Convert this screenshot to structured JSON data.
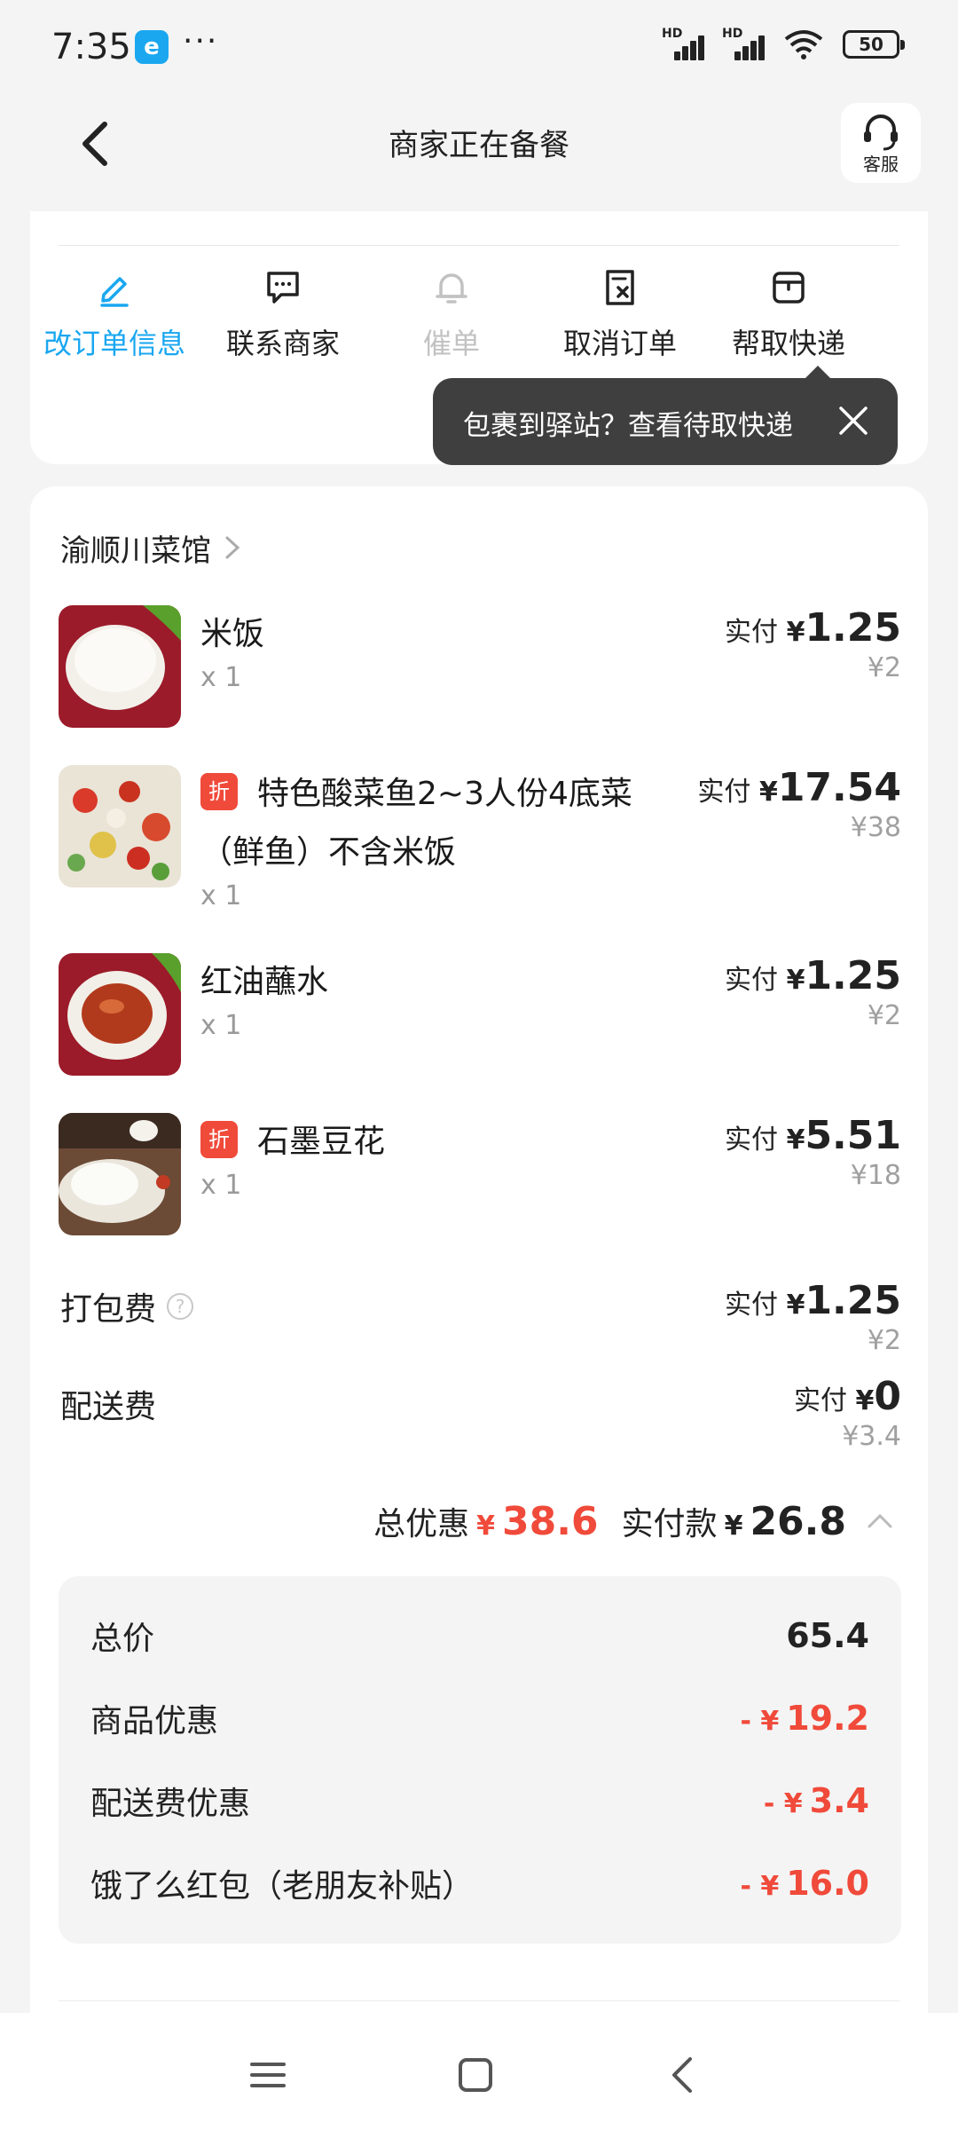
{
  "status_bar": {
    "time": "7:35",
    "app_icon_name": "eleme-app-icon",
    "more": "···",
    "battery": "50"
  },
  "header": {
    "title": "商家正在备餐",
    "service_label": "客服"
  },
  "actions": [
    {
      "label": "改订单信息",
      "icon": "edit-icon",
      "state": "active"
    },
    {
      "label": "联系商家",
      "icon": "chat-icon",
      "state": "normal"
    },
    {
      "label": "催单",
      "icon": "bell-icon",
      "state": "disabled"
    },
    {
      "label": "取消订单",
      "icon": "cancel-doc-icon",
      "state": "normal"
    },
    {
      "label": "帮取快递",
      "icon": "parcel-icon",
      "state": "normal"
    }
  ],
  "tooltip": {
    "text": "包裹到驿站？查看待取快递"
  },
  "shop": {
    "name": "渝顺川菜馆"
  },
  "items": [
    {
      "name": "米饭",
      "qty": "x 1",
      "paid_label": "实付",
      "currency": "¥",
      "paid": "1.25",
      "original": "¥2",
      "discount_badge": ""
    },
    {
      "name": "特色酸菜鱼2~3人份4底菜",
      "name_line2": "（鲜鱼）不含米饭",
      "qty": "x 1",
      "paid_label": "实付",
      "currency": "¥",
      "paid": "17.54",
      "original": "¥38",
      "discount_badge": "折"
    },
    {
      "name": "红油蘸水",
      "qty": "x 1",
      "paid_label": "实付",
      "currency": "¥",
      "paid": "1.25",
      "original": "¥2",
      "discount_badge": ""
    },
    {
      "name": "石墨豆花",
      "qty": "x 1",
      "paid_label": "实付",
      "currency": "¥",
      "paid": "5.51",
      "original": "¥18",
      "discount_badge": "折"
    }
  ],
  "fees": [
    {
      "label": "打包费",
      "help": "?",
      "paid_label": "实付",
      "currency": "¥",
      "paid": "1.25",
      "original": "¥2"
    },
    {
      "label": "配送费",
      "paid_label": "实付",
      "currency": "¥",
      "paid": "0",
      "original": "¥3.4"
    }
  ],
  "summary": {
    "discount_label": "总优惠",
    "discount_currency": "¥",
    "discount_value": "38.6",
    "paid_label": "实付款",
    "paid_currency": "¥",
    "paid_value": "26.8"
  },
  "breakdown": [
    {
      "label": "总价",
      "prefix": "",
      "value": "65.4",
      "color": "#222222"
    },
    {
      "label": "商品优惠",
      "prefix": "- ¥",
      "value": "19.2",
      "color": "#f04a3a"
    },
    {
      "label": "配送费优惠",
      "prefix": "- ¥",
      "value": "3.4",
      "color": "#f04a3a"
    },
    {
      "label": "饿了么红包（老朋友补贴）",
      "prefix": "- ¥",
      "value": "16.0",
      "color": "#f04a3a"
    }
  ],
  "colors": {
    "accent": "#1aa7f0",
    "discount_red": "#f04a3a",
    "tooltip_bg": "#3f3f3f"
  }
}
